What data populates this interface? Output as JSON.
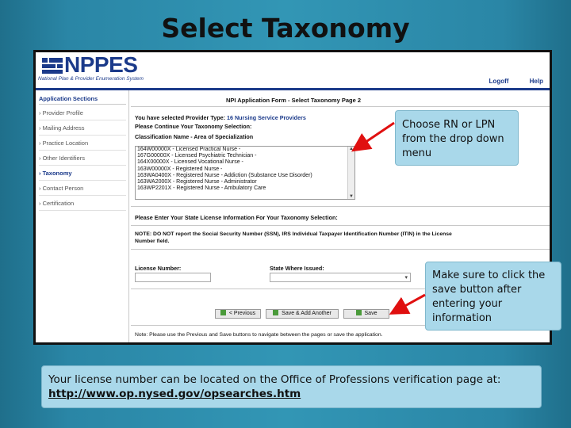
{
  "slide": {
    "title": "Select Taxonomy"
  },
  "app": {
    "logo": "NPPES",
    "subtitle": "National Plan & Provider Enumeration System",
    "links": [
      "Logoff",
      "Help"
    ]
  },
  "sidebar": {
    "title": "Application Sections",
    "items": [
      {
        "label": "Provider Profile",
        "active": false
      },
      {
        "label": "Mailing Address",
        "active": false
      },
      {
        "label": "Practice Location",
        "active": false
      },
      {
        "label": "Other Identifiers",
        "active": false
      },
      {
        "label": "Taxonomy",
        "active": true
      },
      {
        "label": "Contact Person",
        "active": false
      },
      {
        "label": "Certification",
        "active": false
      }
    ]
  },
  "form": {
    "title": "NPI Application Form - Select Taxonomy Page 2",
    "provider_type_label": "You have selected Provider Type:",
    "provider_type_value": "16 Nursing Service Providers",
    "continue_text": "Please Continue Your Taxonomy Selection:",
    "classification_label": "Classification Name - Area of Specialization",
    "taxonomy_options": [
      "164W00000X - Licensed Practical Nurse -",
      "167G00000X - Licensed Psychiatric Technician -",
      "164X00000X - Licensed Vocational Nurse -",
      "163W00000X - Registered Nurse -",
      "163WA0400X - Registered Nurse - Addiction (Substance Use Disorder)",
      "163WA2000X - Registered Nurse - Administrator",
      "163WP2201X - Registered Nurse - Ambulatory Care"
    ],
    "license_prompt": "Please Enter Your State License Information For Your Taxonomy Selection:",
    "note_ssn": "NOTE: DO NOT report the Social Security Number (SSN), IRS Individual Taxpayer Identification Number (ITIN) in the License",
    "note_ssn2": "Number field.",
    "license_number_label": "License Number:",
    "license_number_value": "",
    "state_label": "State Where Issued:",
    "state_value": "",
    "buttons": {
      "previous": "< Previous",
      "save_add": "Save & Add Another",
      "save": "Save"
    },
    "footer_note": "Note: Please use the Previous and Save buttons to navigate between the pages or save the application."
  },
  "callouts": {
    "dropdown": "Choose RN or LPN from the drop down menu",
    "save": "Make sure to click the save button after entering your information"
  },
  "bottom_note": {
    "text": "Your license number can be  located on the Office of Professions  verification page at:",
    "link": "http://www.op.nysed.gov/opsearches.htm"
  },
  "colors": {
    "background": "#3296b5",
    "callout_fill": "#a9d8ea",
    "arrow": "#e01010",
    "brand": "#1b3a8a"
  }
}
